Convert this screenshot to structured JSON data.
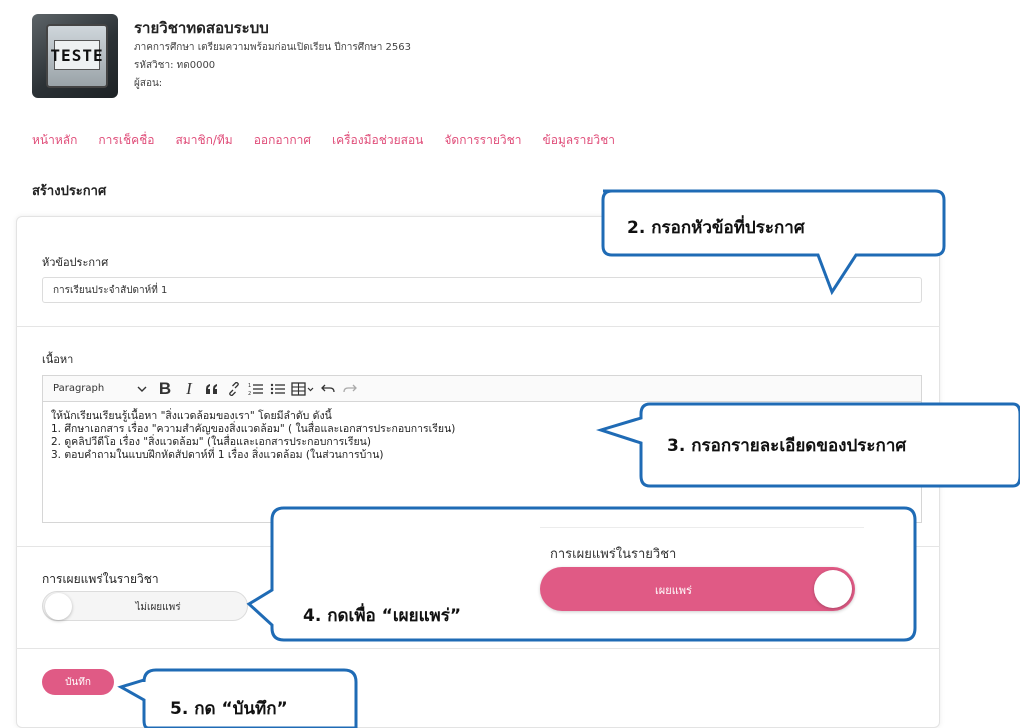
{
  "course": {
    "thumbnail_text": "TESTE",
    "title": "รายวิชาทดสอบระบบ",
    "department_line": "ภาคการศึกษา เตรียมความพร้อมก่อนเปิดเรียน ปีการศึกษา 2563",
    "code_line": "รหัสวิชา: ทด0000",
    "instructor_line": "ผู้สอน:"
  },
  "nav": {
    "items": [
      "หน้าหลัก",
      "การเช็คชื่อ",
      "สมาชิก/ทีม",
      "ออกอากาศ",
      "เครื่องมือช่วยสอน",
      "จัดการรายวิชา",
      "ข้อมูลรายวิชา"
    ]
  },
  "page": {
    "section_title": "สร้างประกาศ"
  },
  "form": {
    "subject_label": "หัวข้อประกาศ",
    "subject_value": "การเรียนประจำสัปดาห์ที่ 1",
    "content_label": "เนื้อหา",
    "toolbar": {
      "paragraph_label": "Paragraph"
    },
    "content_lines": [
      "ให้นักเรียนเรียนรู้เนื้อหา \"สิ่งแวดล้อมของเรา\" โดยมีลำดับ ดังนี้",
      "1. ศึกษาเอกสาร เรื่อง \"ความสำคัญของสิ่งแวดล้อม\" ( ในสื่อและเอกสารประกอบการเรียน)",
      "2. ดูคลิปวีดีโอ เรื่อง \"สิ่งแวดล้อม\" (ในสื่อและเอกสารประกอบการเรียน)",
      "3. ตอบคำถามในแบบฝึกหัดสัปดาห์ที่ 1 เรื่อง สิ่งแวดล้อม (ในส่วนการบ้าน)"
    ],
    "publish_label": "การเผยแพร่ในรายวิชา",
    "publish_toggle_text": "ไม่เผยแพร่",
    "save_label": "บันทึก"
  },
  "callouts": {
    "step2": "2. กรอกหัวข้อที่ประกาศ",
    "step3": "3. กรอกรายละเอียดของประกาศ",
    "step4": "4. กดเพื่อ “เผยแพร่”",
    "step4_inset_title": "การเผยแพร่ในรายวิชา",
    "step4_inset_toggle": "เผยแพร่",
    "step5": "5. กด “บันทึก”"
  },
  "colors": {
    "accent": "#e05a85",
    "nav_link": "#e04e7a",
    "callout_border": "#1f6bb5"
  }
}
